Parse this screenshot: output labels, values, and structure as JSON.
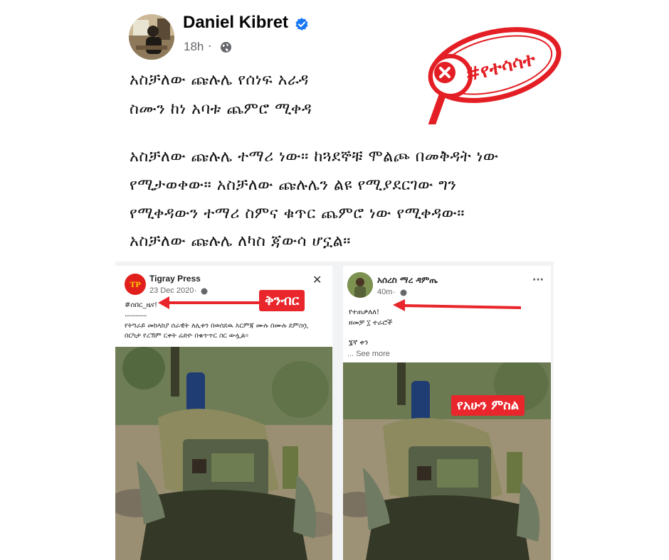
{
  "post": {
    "author": "Daniel Kibret",
    "time": "18h",
    "separator": "·",
    "lines": [
      "አስቻለው ጩሉሌ የሰነፍ አራዳ",
      "ስሙን ከነ አባቱ ጨምሮ ሚቀዳ",
      "አስቻለው ጩሉሌ ተማሪ ነው። ከጓደኞቹ ሞልጮ በመቅዳት ነው",
      "የሚታወቀው። አስቻለው ጩሉሌን ልዩ የሚያደርገው ግን",
      "የሚቀዳውን ተማሪ ስምና ቁጥር ጨምሮ ነው የሚቀዳው።",
      "አስቻለው ጩሉሌ ለካስ ጃውሳ ሆኗል።"
    ]
  },
  "stamp": {
    "text": "#የተሳሳተ",
    "color": "#e31e24"
  },
  "left_post": {
    "page_name": "Tigray Press",
    "logo_text": "TP",
    "date": "23 Dec 2020",
    "separator": "·",
    "hashtag": "#ሰበር_ዜና!",
    "dots": "..............",
    "body": "የትግራይ መከላከያ ሰራዊት ለሊቱን በወሰደዉ እርምጃ ሙሉ በሙሉ ደምስሷ በርካታ የረኽም ርቀት ሬድዮ በቁጥጥር ስር ውሏል።",
    "close": "✕",
    "label": "ቅንብር"
  },
  "right_post": {
    "page_name": "አሰረስ ማረ ዳምጤ",
    "time": "40m",
    "separator": "·",
    "more": "···",
    "line1": "የተጠቃለለ!",
    "line2": "ዘመቻ ፲ ተራሮች",
    "line3": "፮ኛ ቀን",
    "see_more": "... See more",
    "label": "የአሁን ምስል"
  },
  "colors": {
    "accent": "#1877f2",
    "red": "#e8262b",
    "gray": "#65676b"
  },
  "icons": [
    "verified-badge-icon",
    "globe-icon",
    "close-icon",
    "more-options-icon",
    "red-arrow-icon",
    "magnifier-stamp-icon",
    "x-mark-icon"
  ]
}
